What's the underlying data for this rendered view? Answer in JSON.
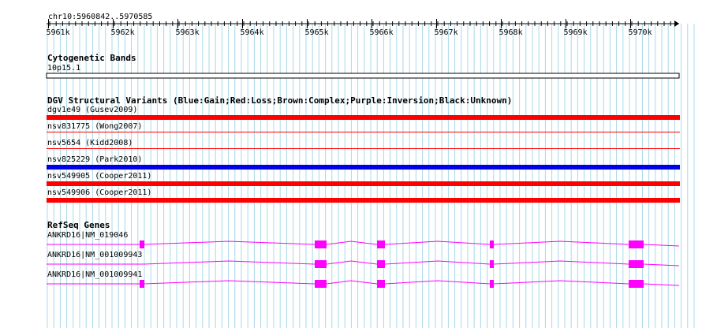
{
  "ruler": {
    "coordinate": "chr10:5960842..5970585",
    "ticks": [
      "5961k",
      "5962k",
      "5963k",
      "5964k",
      "5965k",
      "5966k",
      "5967k",
      "5968k",
      "5969k",
      "5970k"
    ]
  },
  "cytoband": {
    "title": "Cytogenetic Bands",
    "band_label": "10p15.1"
  },
  "dgv": {
    "title": "DGV Structural Variants (Blue:Gain;Red:Loss;Brown:Complex;Purple:Inversion;Black:Unknown)",
    "variants": [
      {
        "label": "dgv1e49 (Gusev2009)",
        "type": "Loss"
      },
      {
        "label": "nsv831775 (Wong2007)",
        "type": "Loss"
      },
      {
        "label": "nsv5654 (Kidd2008)",
        "type": "Loss"
      },
      {
        "label": "nsv825229 (Park2010)",
        "type": "Gain"
      },
      {
        "label": "nsv549905 (Cooper2011)",
        "type": "Loss"
      },
      {
        "label": "nsv549906 (Cooper2011)",
        "type": "Loss"
      }
    ]
  },
  "refseq": {
    "title": "RefSeq Genes",
    "transcripts": [
      {
        "label": "ANKRD16|NM_019046"
      },
      {
        "label": "ANKRD16|NM_001009943"
      },
      {
        "label": "ANKRD16|NM_001009941"
      }
    ]
  },
  "colors": {
    "gain": "#0000e6",
    "loss": "#ff0000",
    "gene": "#ff00ff",
    "grid": "#a8d8e8"
  }
}
